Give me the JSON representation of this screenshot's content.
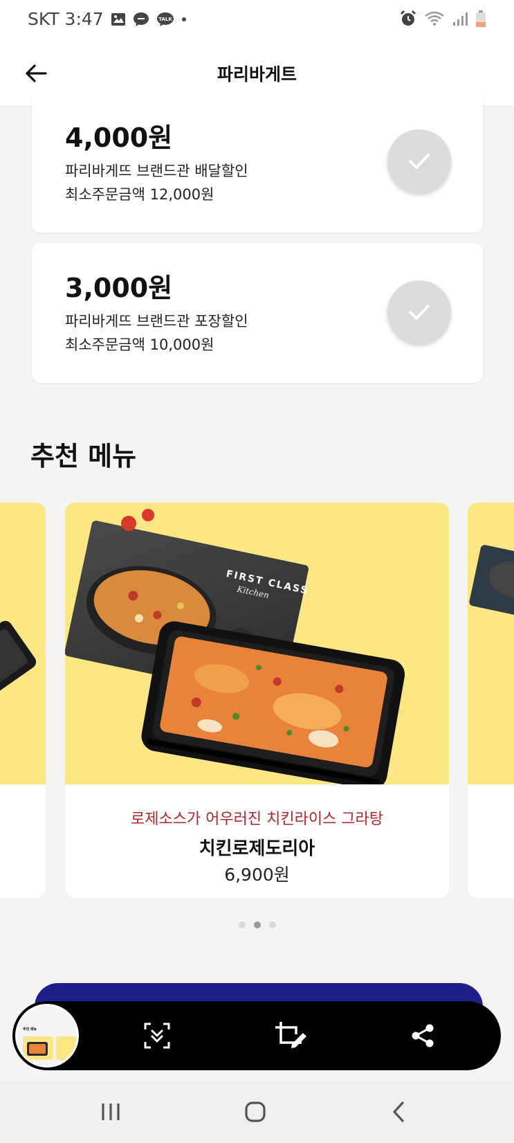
{
  "status_bar": {
    "carrier_time": "SKT 3:47",
    "icons_left": [
      "gallery-icon",
      "message-bubble-icon",
      "talk-icon",
      "dot-icon"
    ],
    "icons_right": [
      "alarm-icon",
      "wifi-icon",
      "signal-icon",
      "battery-icon"
    ],
    "talk_label": "TALK"
  },
  "header": {
    "title": "파리바게트",
    "back_icon": "arrow-left-icon"
  },
  "coupons": [
    {
      "amount": "4,000원",
      "description": "파리바게뜨 브랜드관 배달할인",
      "min_order": "최소주문금액 12,000원",
      "check_icon": "check-icon"
    },
    {
      "amount": "3,000원",
      "description": "파리바게뜨 브랜드관 포장할인",
      "min_order": "최소주문금액 10,000원",
      "check_icon": "check-icon"
    }
  ],
  "recommended": {
    "title": "추천 메뉴",
    "current_item": {
      "subtitle": "로제소스가 어우러진 치킨라이스 그라탕",
      "name": "치킨로제도리아",
      "price": "6,900원",
      "image_box_text": "FIRST CLASS",
      "image_box_subtext": "Kitchen"
    },
    "pager": {
      "count": 3,
      "active": 1
    }
  },
  "screenshot_toolbar": {
    "thumbnail_text": "추천 메뉴",
    "buttons": [
      "scroll-capture-icon",
      "crop-edit-icon",
      "share-icon"
    ]
  },
  "navbar": {
    "buttons": [
      "recent-apps-icon",
      "home-icon",
      "back-icon"
    ]
  },
  "colors": {
    "card_image_bg": "#fde784",
    "subtitle_red": "#b3262b",
    "banner_navy": "#1f1f8a",
    "check_grey": "#dcdcdc"
  }
}
